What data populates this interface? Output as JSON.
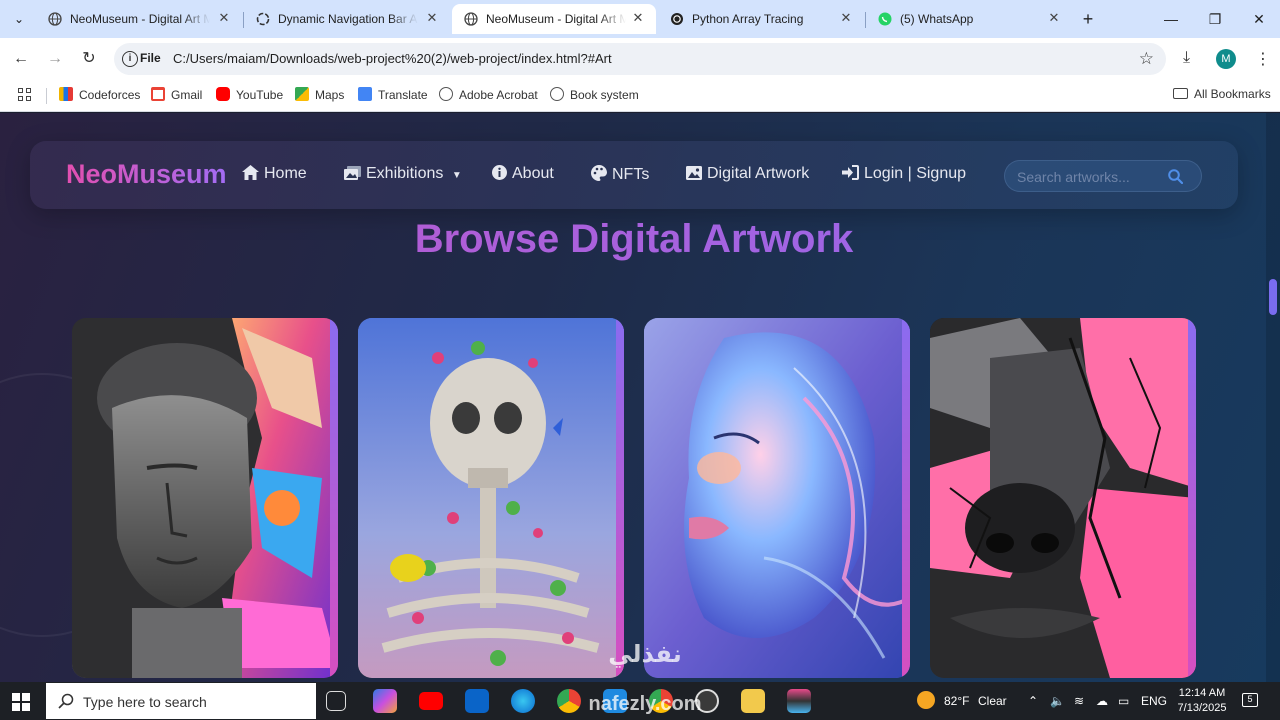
{
  "browser": {
    "tabs": [
      {
        "title": "NeoMuseum - Digital Art Museum",
        "active": false,
        "icon": "globe-icon"
      },
      {
        "title": "Dynamic Navigation Bar Auto",
        "active": false,
        "icon": "openai-icon"
      },
      {
        "title": "NeoMuseum - Digital Art Museum",
        "active": true,
        "icon": "globe-icon"
      },
      {
        "title": "Python Array Tracing",
        "active": false,
        "icon": "openai-icon"
      },
      {
        "title": "(5) WhatsApp",
        "active": false,
        "icon": "whatsapp-icon"
      }
    ],
    "address": {
      "scheme_label": "File",
      "url": "C:/Users/maiam/Downloads/web-project%20(2)/web-project/index.html?#Art"
    },
    "profile_initial": "M",
    "bookmarks": [
      {
        "label": "Codeforces",
        "color": "#f0b400"
      },
      {
        "label": "Gmail",
        "color": "#ea4335"
      },
      {
        "label": "YouTube",
        "color": "#ff0000"
      },
      {
        "label": "Maps",
        "color": "#34a853"
      },
      {
        "label": "Translate",
        "color": "#4285f4"
      },
      {
        "label": "Adobe Acrobat",
        "color": "#555555"
      },
      {
        "label": "Book system",
        "color": "#555555"
      }
    ],
    "all_bookmarks_label": "All Bookmarks"
  },
  "site": {
    "brand": "NeoMuseum",
    "nav": [
      {
        "label": "Home",
        "icon": "home-icon"
      },
      {
        "label": "Exhibitions",
        "icon": "image-stack-icon",
        "dropdown": true
      },
      {
        "label": "About",
        "icon": "info-icon"
      },
      {
        "label": "NFTs",
        "icon": "palette-icon"
      },
      {
        "label": "Digital Artwork",
        "icon": "picture-icon"
      },
      {
        "label": "Login | Signup",
        "icon": "sign-in-icon"
      }
    ],
    "search_placeholder": "Search artworks...",
    "heading": "Browse Digital Artwork",
    "colors": {
      "brand_gradient_start": "#e24fb0",
      "brand_gradient_end": "#a36df5",
      "accent": "#8a6cf0"
    },
    "artworks": [
      {
        "subject": "marble bust with colorful crystals"
      },
      {
        "subject": "flower-covered skeleton with yellow bird"
      },
      {
        "subject": "iridescent face portrait"
      },
      {
        "subject": "cracked pink and black face"
      }
    ]
  },
  "taskbar": {
    "search_placeholder": "Type here to search",
    "weather": {
      "temp": "82°F",
      "condition": "Clear"
    },
    "language": "ENG",
    "time": "12:14 AM",
    "date": "7/13/2025",
    "notifications": "5"
  },
  "watermark": {
    "arabic": "نفذلي",
    "latin": "nafezly.com"
  }
}
